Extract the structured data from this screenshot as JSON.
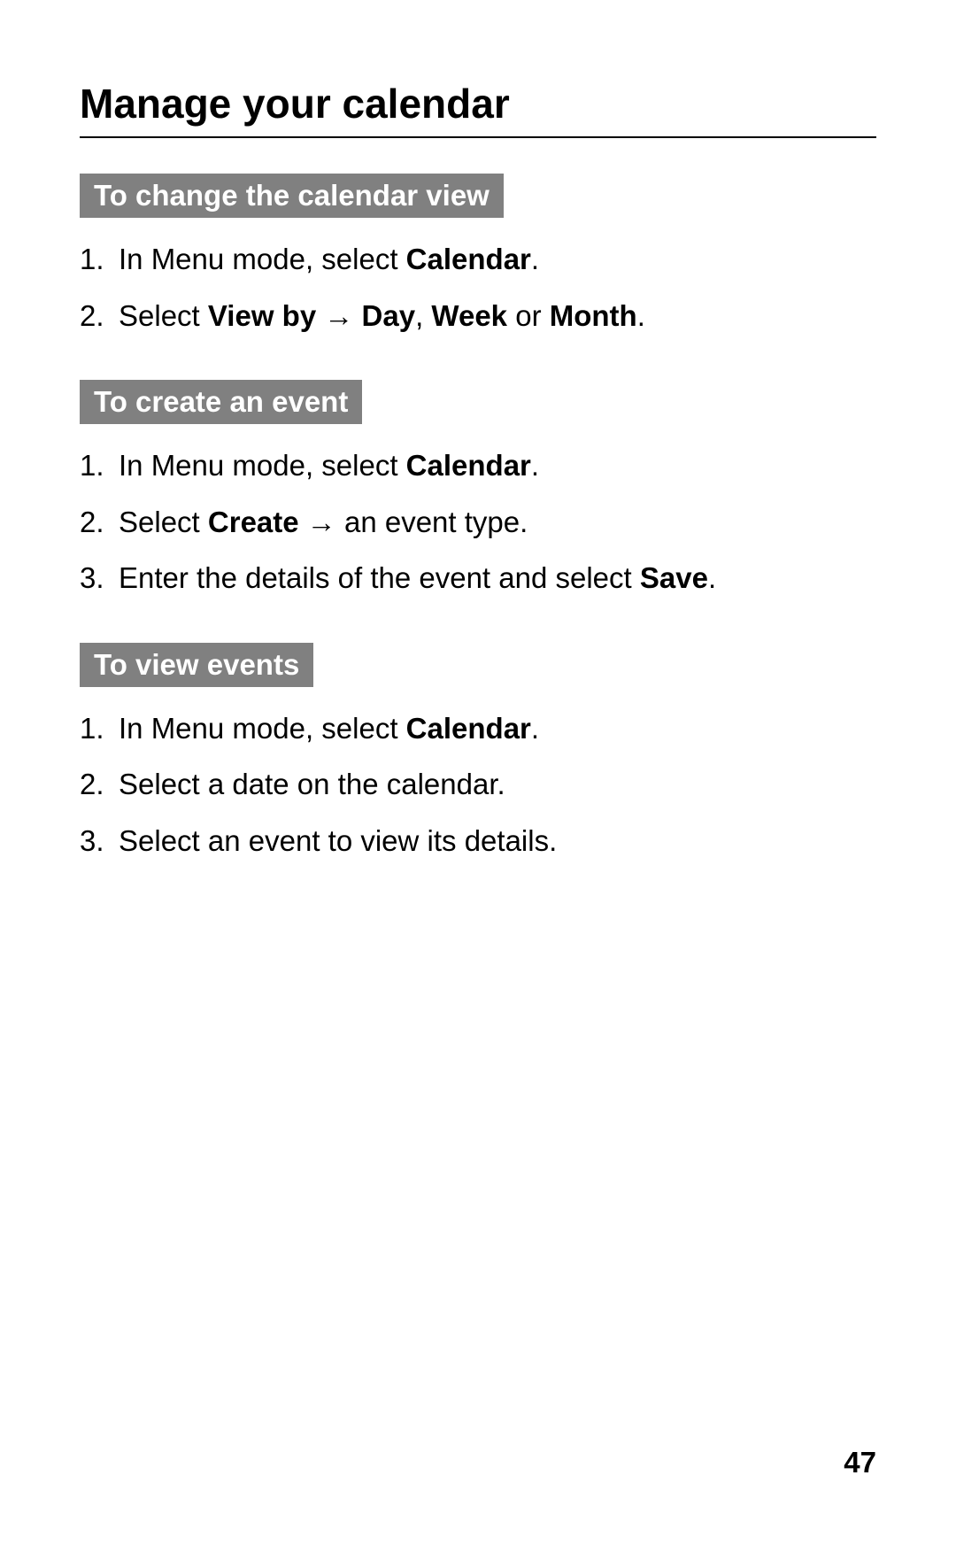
{
  "title": "Manage your calendar",
  "sections": [
    {
      "heading": "To change the calendar view",
      "steps": [
        [
          {
            "text": "In Menu mode, select ",
            "bold": false
          },
          {
            "text": "Calendar",
            "bold": true
          },
          {
            "text": ".",
            "bold": false
          }
        ],
        [
          {
            "text": "Select ",
            "bold": false
          },
          {
            "text": "View by",
            "bold": true
          },
          {
            "text": " → ",
            "bold": false,
            "arrow": true
          },
          {
            "text": "Day",
            "bold": true
          },
          {
            "text": ", ",
            "bold": false
          },
          {
            "text": "Week",
            "bold": true
          },
          {
            "text": " or ",
            "bold": false
          },
          {
            "text": "Month",
            "bold": true
          },
          {
            "text": ".",
            "bold": false
          }
        ]
      ]
    },
    {
      "heading": "To create an event",
      "steps": [
        [
          {
            "text": "In Menu mode, select ",
            "bold": false
          },
          {
            "text": "Calendar",
            "bold": true
          },
          {
            "text": ".",
            "bold": false
          }
        ],
        [
          {
            "text": "Select ",
            "bold": false
          },
          {
            "text": "Create",
            "bold": true
          },
          {
            "text": " → an event type.",
            "bold": false
          }
        ],
        [
          {
            "text": "Enter the details of the event and select ",
            "bold": false
          },
          {
            "text": "Save",
            "bold": true
          },
          {
            "text": ".",
            "bold": false
          }
        ]
      ]
    },
    {
      "heading": "To view events",
      "steps": [
        [
          {
            "text": "In Menu mode, select ",
            "bold": false
          },
          {
            "text": "Calendar",
            "bold": true
          },
          {
            "text": ".",
            "bold": false
          }
        ],
        [
          {
            "text": "Select a date on the calendar.",
            "bold": false
          }
        ],
        [
          {
            "text": "Select an event to view its details.",
            "bold": false
          }
        ]
      ]
    }
  ],
  "pageNumber": "47"
}
